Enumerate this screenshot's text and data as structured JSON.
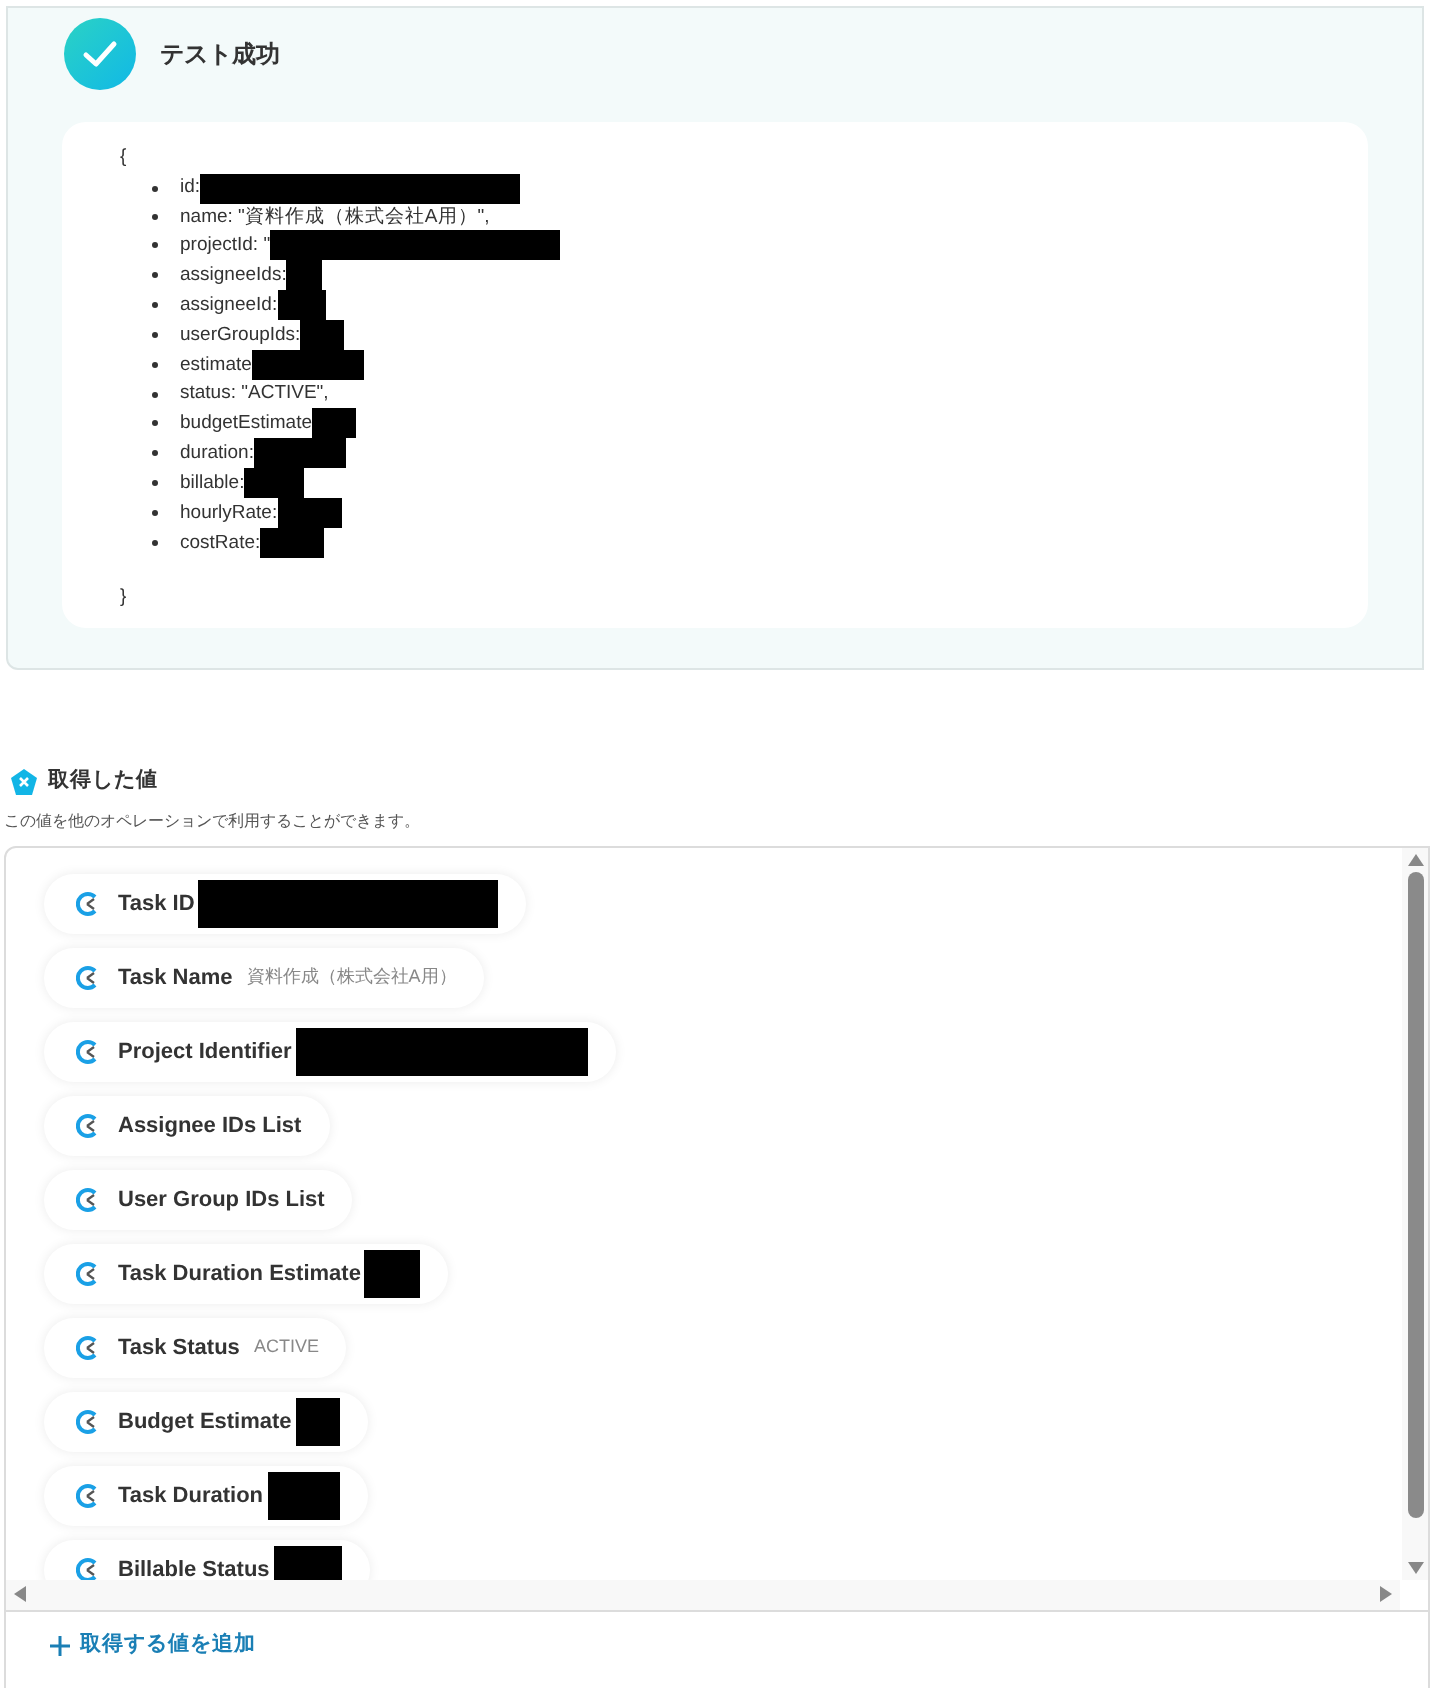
{
  "result": {
    "title": "テスト成功",
    "open_brace": "{",
    "close_brace": "}",
    "lines": [
      {
        "text": "id:",
        "redacted": true
      },
      {
        "text": "name: \"資料作成（株式会社A用）\",",
        "redacted": false
      },
      {
        "text": "projectId: \"",
        "redacted": true
      },
      {
        "text": "assigneeIds:",
        "redacted": true
      },
      {
        "text": "assigneeId:",
        "redacted": true
      },
      {
        "text": "userGroupIds:",
        "redacted": true
      },
      {
        "text": "estimate",
        "redacted": true
      },
      {
        "text": "status: \"ACTIVE\",",
        "redacted": false
      },
      {
        "text": "budgetEstimate",
        "redacted": true
      },
      {
        "text": "duration:",
        "redacted": true
      },
      {
        "text": "billable:",
        "redacted": true
      },
      {
        "text": "hourlyRate:",
        "redacted": true
      },
      {
        "text": "costRate:",
        "redacted": true
      }
    ]
  },
  "values": {
    "title": "取得した値",
    "description": "この値を他のオペレーションで利用することができます。",
    "items": [
      {
        "label": "Task ID",
        "redacted": true
      },
      {
        "label": "Task Name",
        "value": "資料作成（株式会社A用）",
        "redacted": false
      },
      {
        "label": "Project Identifier",
        "redacted": true
      },
      {
        "label": "Assignee IDs List",
        "redacted": false
      },
      {
        "label": "User Group IDs List",
        "redacted": false
      },
      {
        "label": "Task Duration Estimate",
        "redacted": true
      },
      {
        "label": "Task Status",
        "value": "ACTIVE",
        "redacted": false
      },
      {
        "label": "Budget Estimate",
        "redacted": true
      },
      {
        "label": "Task Duration",
        "redacted": true
      },
      {
        "label": "Billable Status",
        "redacted": true
      }
    ],
    "add_link": "取得する値を追加"
  }
}
